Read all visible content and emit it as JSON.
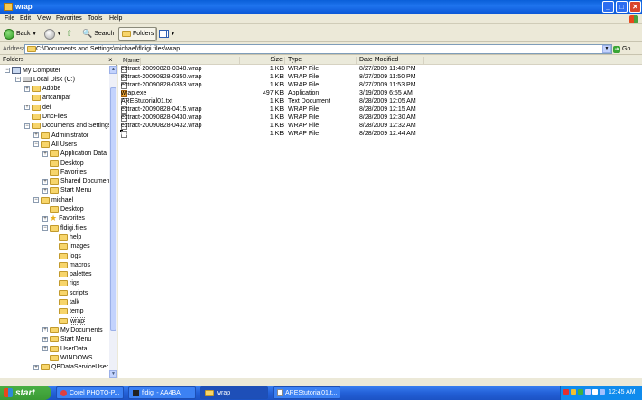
{
  "window": {
    "title": "wrap",
    "buttons": {
      "minimize": "_",
      "maximize": "□",
      "close": "✕"
    }
  },
  "menu": [
    "File",
    "Edit",
    "View",
    "Favorites",
    "Tools",
    "Help"
  ],
  "toolbar": {
    "back": "Back",
    "search": "Search",
    "folders": "Folders"
  },
  "address": {
    "label": "Address",
    "path": "C:\\Documents and Settings\\michael\\fldigi.files\\wrap",
    "go": "Go"
  },
  "folders_pane": {
    "title": "Folders",
    "close": "×",
    "tree": [
      {
        "label": "My Computer",
        "level": 0,
        "expander": "−",
        "icon": "computer"
      },
      {
        "label": "Local Disk (C:)",
        "level": 1,
        "expander": "−",
        "icon": "drive"
      },
      {
        "label": "Adobe",
        "level": 2,
        "expander": "+",
        "icon": "folder"
      },
      {
        "label": "artcampaf",
        "level": 2,
        "expander": "",
        "icon": "folder"
      },
      {
        "label": "del",
        "level": 2,
        "expander": "+",
        "icon": "folder"
      },
      {
        "label": "DncFiles",
        "level": 2,
        "expander": "",
        "icon": "folder"
      },
      {
        "label": "Documents and Settings",
        "level": 2,
        "expander": "−",
        "icon": "folder"
      },
      {
        "label": "Administrator",
        "level": 3,
        "expander": "+",
        "icon": "folder"
      },
      {
        "label": "All Users",
        "level": 3,
        "expander": "−",
        "icon": "folder"
      },
      {
        "label": "Application Data",
        "level": 4,
        "expander": "+",
        "icon": "folder"
      },
      {
        "label": "Desktop",
        "level": 4,
        "expander": "",
        "icon": "folder"
      },
      {
        "label": "Favorites",
        "level": 4,
        "expander": "",
        "icon": "folder"
      },
      {
        "label": "Shared Documents",
        "level": 4,
        "expander": "+",
        "icon": "folder"
      },
      {
        "label": "Start Menu",
        "level": 4,
        "expander": "+",
        "icon": "folder"
      },
      {
        "label": "michael",
        "level": 3,
        "expander": "−",
        "icon": "folder"
      },
      {
        "label": "Desktop",
        "level": 4,
        "expander": "",
        "icon": "folder"
      },
      {
        "label": "Favorites",
        "level": 4,
        "expander": "+",
        "icon": "star"
      },
      {
        "label": "fldigi.files",
        "level": 4,
        "expander": "−",
        "icon": "folder"
      },
      {
        "label": "help",
        "level": 5,
        "expander": "",
        "icon": "folder"
      },
      {
        "label": "images",
        "level": 5,
        "expander": "",
        "icon": "folder"
      },
      {
        "label": "logs",
        "level": 5,
        "expander": "",
        "icon": "folder"
      },
      {
        "label": "macros",
        "level": 5,
        "expander": "",
        "icon": "folder"
      },
      {
        "label": "palettes",
        "level": 5,
        "expander": "",
        "icon": "folder"
      },
      {
        "label": "rigs",
        "level": 5,
        "expander": "",
        "icon": "folder"
      },
      {
        "label": "scripts",
        "level": 5,
        "expander": "",
        "icon": "folder"
      },
      {
        "label": "talk",
        "level": 5,
        "expander": "",
        "icon": "folder"
      },
      {
        "label": "temp",
        "level": 5,
        "expander": "",
        "icon": "folder"
      },
      {
        "label": "wrap",
        "level": 5,
        "expander": "",
        "icon": "folder-open"
      },
      {
        "label": "My Documents",
        "level": 4,
        "expander": "+",
        "icon": "folder"
      },
      {
        "label": "Start Menu",
        "level": 4,
        "expander": "+",
        "icon": "folder"
      },
      {
        "label": "UserData",
        "level": 4,
        "expander": "+",
        "icon": "folder"
      },
      {
        "label": "WINDOWS",
        "level": 4,
        "expander": "",
        "icon": "folder"
      },
      {
        "label": "QBDataServiceUser",
        "level": 3,
        "expander": "+",
        "icon": "folder"
      }
    ]
  },
  "columns": {
    "name": "Name",
    "size": "Size",
    "type": "Type",
    "modified": "Date Modified"
  },
  "files": [
    {
      "name": "extract-20090828-0348.wrap",
      "size": "1 KB",
      "type": "WRAP File",
      "modified": "8/27/2009 11:48 PM",
      "icon": "doc"
    },
    {
      "name": "extract-20090828-0350.wrap",
      "size": "1 KB",
      "type": "WRAP File",
      "modified": "8/27/2009 11:50 PM",
      "icon": "doc"
    },
    {
      "name": "extract-20090828-0353.wrap",
      "size": "1 KB",
      "type": "WRAP File",
      "modified": "8/27/2009 11:53 PM",
      "icon": "doc"
    },
    {
      "name": "wrap.exe",
      "size": "497 KB",
      "type": "Application",
      "modified": "3/19/2009 6:55 AM",
      "icon": "app"
    },
    {
      "name": "AREStutorial01.txt",
      "size": "1 KB",
      "type": "Text Document",
      "modified": "8/28/2009 12:05 AM",
      "icon": "doc"
    },
    {
      "name": "extract-20090828-0415.wrap",
      "size": "1 KB",
      "type": "WRAP File",
      "modified": "8/28/2009 12:15 AM",
      "icon": "doc"
    },
    {
      "name": "extract-20090828-0430.wrap",
      "size": "1 KB",
      "type": "WRAP File",
      "modified": "8/28/2009 12:30 AM",
      "icon": "doc"
    },
    {
      "name": "extract-20090828-0432.wrap",
      "size": "1 KB",
      "type": "WRAP File",
      "modified": "8/28/2009 12:32 AM",
      "icon": "doc"
    },
    {
      "name": "extract-20090828-0444.wrap",
      "size": "1 KB",
      "type": "WRAP File",
      "modified": "8/28/2009 12:44 AM",
      "icon": "doc",
      "selected": true
    }
  ],
  "taskbar": {
    "start": "start",
    "tasks": [
      {
        "label": "Corel PHOTO-P...",
        "icon": "corel-icon"
      },
      {
        "label": "fldigi - AA4BA",
        "icon": "fldigi-icon"
      },
      {
        "label": "wrap",
        "icon": "folder-icon",
        "active": true
      },
      {
        "label": "AREStutorial01.t...",
        "icon": "notepad-icon"
      }
    ],
    "clock": "12:45 AM"
  },
  "colors": {
    "selection": "#316ac5",
    "title_blue": "#0a5fd8",
    "taskbar_blue": "#2461d8",
    "start_green": "#3a9a34"
  }
}
